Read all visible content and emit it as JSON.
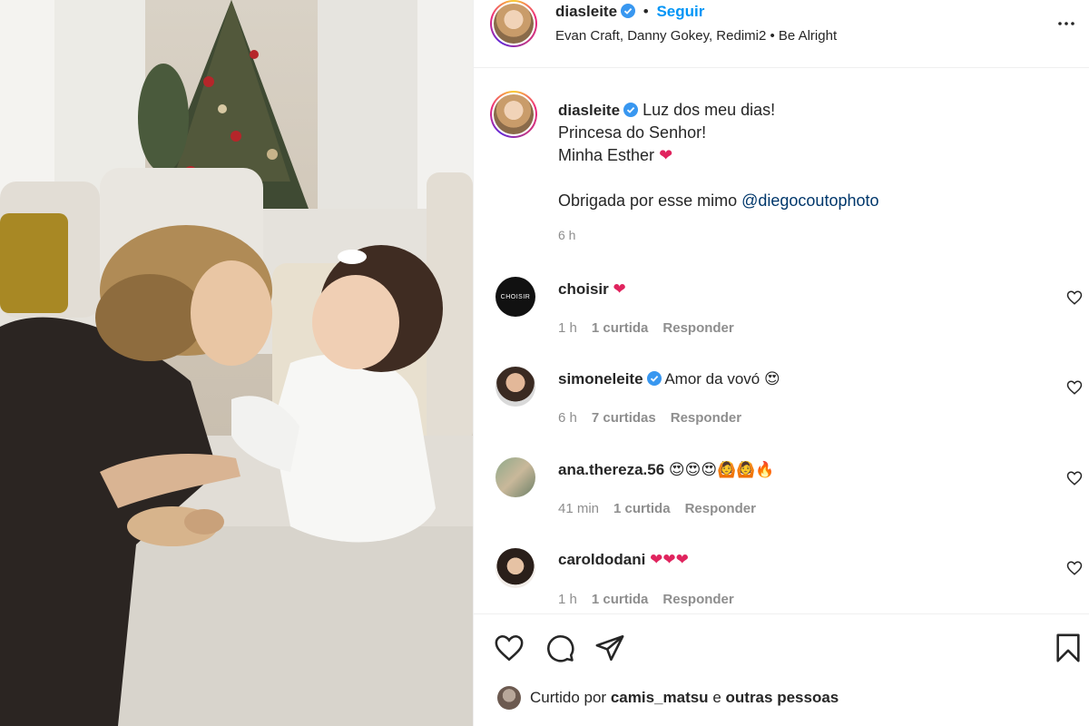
{
  "post": {
    "username": "diasleite",
    "follow_label": "Seguir",
    "audio": "Evan Craft, Danny Gokey, Redimi2 • Be Alright",
    "separator": "•"
  },
  "caption": {
    "username": "diasleite",
    "lines": [
      "Luz dos meu dias!",
      "Princesa do Senhor!",
      "Minha Esther"
    ],
    "thanks": "Obrigada por esse mimo",
    "mention": "@diegocoutophoto",
    "time": "6 h"
  },
  "comments": [
    {
      "username": "choisir",
      "text": "",
      "emojis": "❤",
      "time": "1 h",
      "likes": "1 curtida",
      "reply": "Responder",
      "verified": false,
      "avatar_text": "CHOISIR"
    },
    {
      "username": "simoneleite",
      "text": "Amor da vovó",
      "emojis": "😍",
      "time": "6 h",
      "likes": "7 curtidas",
      "reply": "Responder",
      "verified": true
    },
    {
      "username": "ana.thereza.56",
      "text": "",
      "emojis": "😍😍😍🙆🙆🔥",
      "time": "41 min",
      "likes": "1 curtida",
      "reply": "Responder",
      "verified": false
    },
    {
      "username": "caroldodani",
      "text": "",
      "emojis": "❤❤❤",
      "time": "1 h",
      "likes": "1 curtida",
      "reply": "Responder",
      "verified": false
    }
  ],
  "likes": {
    "prefix": "Curtido por",
    "user": "camis_matsu",
    "joiner": "e",
    "others": "outras pessoas"
  },
  "icons": {
    "more": "more-horizontal-icon",
    "verified": "verified-badge-icon",
    "like": "heart-icon",
    "comment": "comment-icon",
    "share": "share-icon",
    "save": "bookmark-icon"
  },
  "colors": {
    "accent": "#0095f6",
    "mention": "#00376b",
    "muted": "#8e8e8e",
    "heart": "#e0245e"
  }
}
